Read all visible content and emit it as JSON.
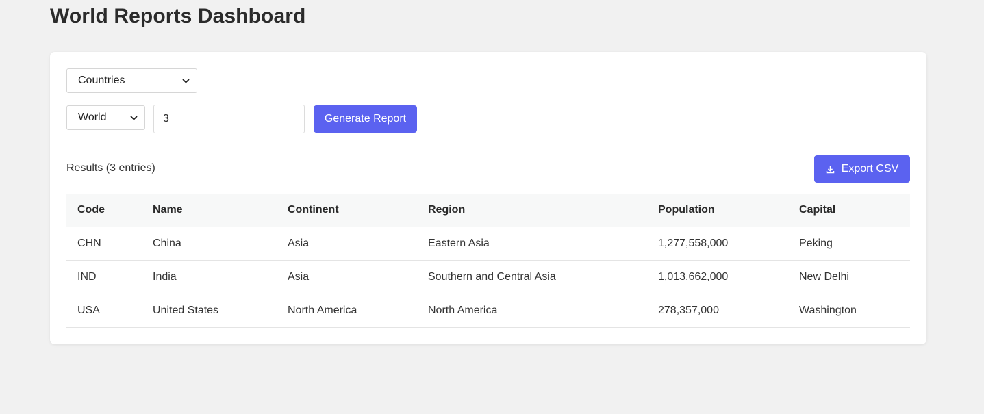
{
  "page": {
    "title": "World Reports Dashboard"
  },
  "controls": {
    "report_type": "Countries",
    "scope": "World",
    "count_value": "3",
    "generate_label": "Generate Report"
  },
  "results": {
    "label": "Results (3 entries)",
    "export_label": "Export CSV"
  },
  "table": {
    "headers": [
      "Code",
      "Name",
      "Continent",
      "Region",
      "Population",
      "Capital"
    ],
    "rows": [
      [
        "CHN",
        "China",
        "Asia",
        "Eastern Asia",
        "1,277,558,000",
        "Peking"
      ],
      [
        "IND",
        "India",
        "Asia",
        "Southern and Central Asia",
        "1,013,662,000",
        "New Delhi"
      ],
      [
        "USA",
        "United States",
        "North America",
        "North America",
        "278,357,000",
        "Washington"
      ]
    ]
  },
  "colors": {
    "accent": "#5b62f0",
    "background": "#f1f1f1",
    "card": "#ffffff"
  },
  "icons": {
    "export": "download-icon",
    "dropdown": "chevron-down-icon"
  }
}
